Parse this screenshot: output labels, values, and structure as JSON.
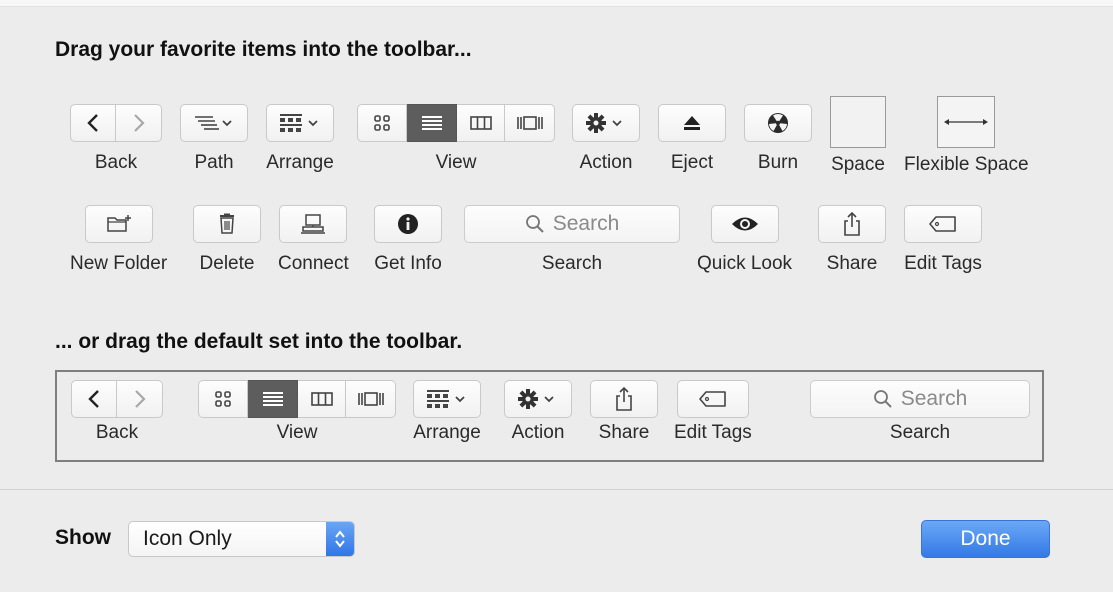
{
  "palette": {
    "background": "#ececec",
    "accent": "#3479e6",
    "active_segment": "#5d5d5d"
  },
  "heading_favorites": "Drag your favorite items into the toolbar...",
  "heading_default": "... or drag the default set into the toolbar.",
  "items": {
    "back": "Back",
    "path": "Path",
    "arrange": "Arrange",
    "view": "View",
    "action": "Action",
    "eject": "Eject",
    "burn": "Burn",
    "space": "Space",
    "flexible_space": "Flexible Space",
    "new_folder": "New Folder",
    "delete": "Delete",
    "connect": "Connect",
    "get_info": "Get Info",
    "search": "Search",
    "quick_look": "Quick Look",
    "share": "Share",
    "edit_tags": "Edit Tags"
  },
  "search_placeholder": "Search",
  "default_set": {
    "back": "Back",
    "view": "View",
    "arrange": "Arrange",
    "action": "Action",
    "share": "Share",
    "edit_tags": "Edit Tags",
    "search": "Search",
    "search_placeholder": "Search"
  },
  "footer": {
    "show_label": "Show",
    "show_value": "Icon Only",
    "done_label": "Done"
  },
  "icons": [
    "chevron-left-icon",
    "chevron-right-icon",
    "path-icon",
    "arrange-icon",
    "view-icons-icon",
    "view-list-icon",
    "view-columns-icon",
    "view-coverflow-icon",
    "gear-icon",
    "eject-icon",
    "burn-icon",
    "new-folder-icon",
    "trash-icon",
    "connect-icon",
    "info-icon",
    "magnifier-icon",
    "eye-icon",
    "share-icon",
    "tag-icon"
  ]
}
